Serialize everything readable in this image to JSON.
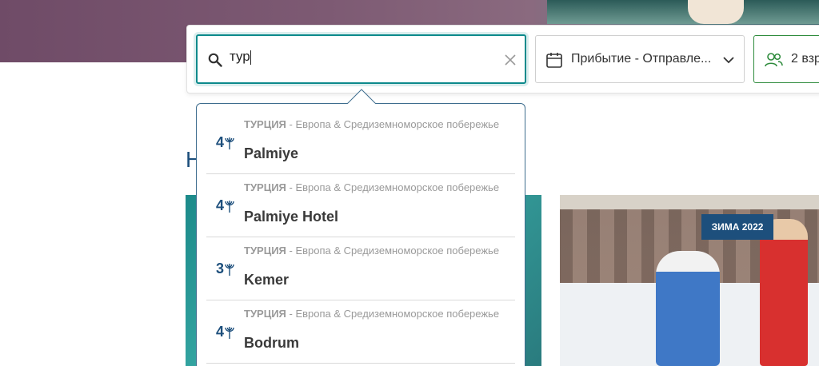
{
  "search": {
    "value": "тур",
    "clear_label": "×"
  },
  "dates": {
    "label": "Прибытие - Отправле..."
  },
  "guests": {
    "label": "2 взр"
  },
  "results": [
    {
      "tridents": "4",
      "country": "ТУРЦИЯ",
      "region": " - Европа & Средиземноморское побережье",
      "name": "Palmiye"
    },
    {
      "tridents": "4",
      "country": "ТУРЦИЯ",
      "region": " - Европа & Средиземноморское побережье",
      "name": "Palmiye Hotel"
    },
    {
      "tridents": "3",
      "country": "ТУРЦИЯ",
      "region": " - Европа & Средиземноморское побережье",
      "name": "Kemer"
    },
    {
      "tridents": "4",
      "country": "ТУРЦИЯ",
      "region": " - Европа & Средиземноморское побережье",
      "name": "Bodrum"
    }
  ],
  "section": {
    "heading_partial": "Н"
  },
  "cards": {
    "right_badge": "ЗИМА 2022"
  },
  "colors": {
    "accent_teal": "#0c8a8c",
    "brand_blue": "#1d4f7c",
    "guests_green": "#2e8b3c",
    "muted_text": "#9a9a9a"
  },
  "icons": {
    "search": "search-icon",
    "clear": "close-icon",
    "calendar": "calendar-icon",
    "chevron": "chevron-down-icon",
    "guests": "users-icon",
    "trident": "trident-icon"
  }
}
